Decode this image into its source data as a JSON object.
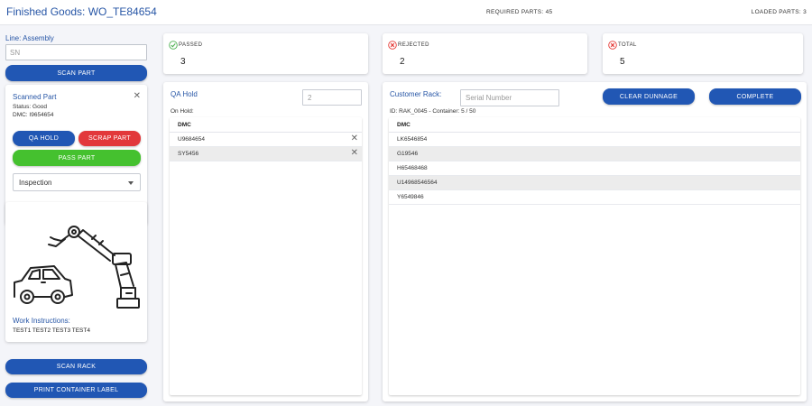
{
  "header": {
    "title": "Finished Goods: WO_TE84654",
    "required_parts": "REQUIRED PARTS: 45",
    "loaded_parts": "LOADED PARTS: 3"
  },
  "sidebar": {
    "line_label": "Line: Assembly",
    "sn_placeholder": "SN",
    "scan_part_label": "SCAN PART",
    "scanned_part": {
      "title": "Scanned Part",
      "status": "Status: Good",
      "dmc": "DMC: I9654654",
      "qa_hold_label": "QA HOLD",
      "scrap_part_label": "SCRAP PART",
      "pass_part_label": "PASS PART",
      "station_selected": "Inspection"
    },
    "work_instructions": {
      "label": "Work Instructions:",
      "text": "TEST1 TEST2 TEST3 TEST4"
    },
    "scan_rack_label": "SCAN RACK",
    "print_label": "PRINT CONTAINER LABEL"
  },
  "stats": [
    {
      "label": "PASSED",
      "value": "3",
      "icon": "check-circle-icon",
      "color": "#4caf50"
    },
    {
      "label": "REJECTED",
      "value": "2",
      "icon": "x-circle-icon",
      "color": "#e53935"
    },
    {
      "label": "TOTAL",
      "value": "5",
      "icon": "x-circle-icon",
      "color": "#e53935"
    }
  ],
  "qa_hold": {
    "title": "QA Hold",
    "input_value": "2",
    "on_hold_label": "On Hold:",
    "column": "DMC",
    "rows": [
      "U9684654",
      "SY5456"
    ]
  },
  "customer_rack": {
    "title": "Customer Rack:",
    "serial_placeholder": "Serial Number",
    "clear_label": "CLEAR DUNNAGE",
    "complete_label": "COMPLETE",
    "info": "ID: RAK_0045 - Container: 5 / 50",
    "column": "DMC",
    "rows": [
      "LK6546854",
      "G19546",
      "H65468468",
      "U14968546564",
      "Y6549846"
    ]
  },
  "colors": {
    "primary": "#2157b4",
    "danger": "#e2383b",
    "success": "#45c12f",
    "title_blue": "#2756a6"
  }
}
